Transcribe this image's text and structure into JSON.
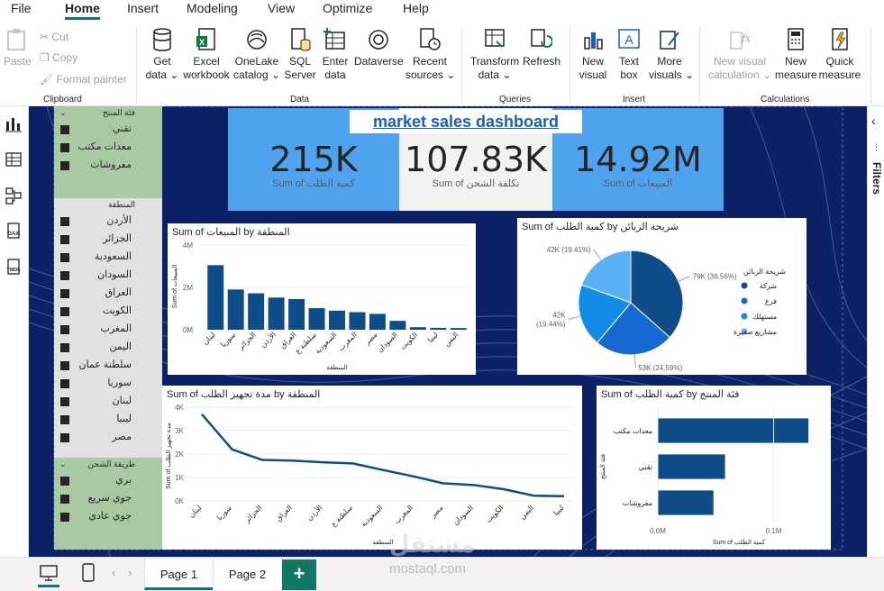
{
  "menu": {
    "items": [
      "File",
      "Home",
      "Insert",
      "Modeling",
      "View",
      "Optimize",
      "Help"
    ],
    "active": "Home"
  },
  "ribbon": {
    "clipboard": {
      "paste": "Paste",
      "cut": "Cut",
      "copy": "Copy",
      "format_painter": "Format painter",
      "group": "Clipboard"
    },
    "data": {
      "group": "Data",
      "buttons": [
        {
          "l1": "Get",
          "l2": "data ⌄"
        },
        {
          "l1": "Excel",
          "l2": "workbook"
        },
        {
          "l1": "OneLake",
          "l2": "catalog ⌄"
        },
        {
          "l1": "SQL",
          "l2": "Server"
        },
        {
          "l1": "Enter",
          "l2": "data"
        },
        {
          "l1": "Dataverse",
          "l2": ""
        },
        {
          "l1": "Recent",
          "l2": "sources ⌄"
        }
      ]
    },
    "queries": {
      "group": "Queries",
      "buttons": [
        {
          "l1": "Transform",
          "l2": "data ⌄"
        },
        {
          "l1": "Refresh",
          "l2": ""
        }
      ]
    },
    "insert": {
      "group": "Insert",
      "buttons": [
        {
          "l1": "New",
          "l2": "visual"
        },
        {
          "l1": "Text",
          "l2": "box"
        },
        {
          "l1": "More",
          "l2": "visuals ⌄"
        }
      ]
    },
    "calculations": {
      "group": "Calculations",
      "buttons": [
        {
          "l1": "New visual",
          "l2": "calculation ⌄"
        },
        {
          "l1": "New",
          "l2": "measure"
        },
        {
          "l1": "Quick",
          "l2": "measure"
        }
      ]
    }
  },
  "right_pane": {
    "label": "Filters"
  },
  "pages": {
    "tabs": [
      "Page 1",
      "Page 2"
    ],
    "active": "Page 1",
    "add": "+"
  },
  "watermark": {
    "logo": "مستقل",
    "url": "mostaql.com"
  },
  "dashboard": {
    "title": "market sales dashboard",
    "kpis": [
      {
        "value": "215K",
        "label": "Sum of كمية الطلب"
      },
      {
        "value": "107.83K",
        "label": "Sum of تكلفة الشحن"
      },
      {
        "value": "14.92M",
        "label": "Sum of المبيعات"
      }
    ],
    "slicers": {
      "category": {
        "title": "فئة المنتج",
        "items": [
          "تقني",
          "معدات مكتب",
          "مفروشات"
        ]
      },
      "region": {
        "title": "المنطقة",
        "items": [
          "الأردن",
          "الجزائر",
          "السعودية",
          "السودان",
          "العراق",
          "الكويت",
          "المغرب",
          "اليمن",
          "سلطنة عمان",
          "سوريا",
          "لبنان",
          "ليبيا",
          "مصر"
        ]
      },
      "shipping": {
        "title": "طريقة الشحن",
        "items": [
          "بري",
          "جوي سريع",
          "جوي عادي"
        ]
      }
    }
  },
  "chart_data": [
    {
      "id": "sales-by-region",
      "type": "bar",
      "title": "Sum of المبيعات by المنطقة",
      "xlabel": "المنطقة",
      "ylabel": "Sum of المبيعات",
      "categories": [
        "لبنان",
        "سوريا",
        "الجزائر",
        "الأردن",
        "العراق",
        "سلطنة ع",
        "السعودية",
        "المغرب",
        "مصر",
        "السودان",
        "الكويت",
        "ليبيا",
        "اليمن"
      ],
      "values": [
        3.05,
        1.9,
        1.72,
        1.52,
        1.45,
        1.02,
        0.9,
        0.83,
        0.75,
        0.42,
        0.12,
        0.09,
        0.08
      ],
      "ylim": [
        0,
        4
      ],
      "yticks": [
        "0M",
        "2M",
        "4M"
      ],
      "color": "#0f4c8a"
    },
    {
      "id": "quantity-by-segment",
      "type": "pie",
      "title": "Sum of كمية الطلب by شريحة الزبائن",
      "legend_title": "شريحة الزبائن",
      "legend_position": "right",
      "labels": [
        "شركة",
        "فرع",
        "مستهلك",
        "مشاريع صغيرة"
      ],
      "values": [
        79,
        53,
        42,
        42
      ],
      "data_labels": [
        "79K (36.56%)",
        "53K (24.59%)",
        "42K (19.44%)",
        "42K (19.41%)"
      ],
      "colors": [
        "#0f4c8a",
        "#1769d2",
        "#118de8",
        "#5ab0f2"
      ]
    },
    {
      "id": "prep-by-region",
      "type": "line",
      "title": "Sum of مدة تجهيز الطلب by المنطقة",
      "xlabel": "المنطقة",
      "ylabel": "Sum of مدة تجهيز الطلب",
      "categories": [
        "لبنان",
        "سوريا",
        "الجزائر",
        "العراق",
        "الأردن",
        "سلطنة ع",
        "السعودية",
        "المغرب",
        "مصر",
        "السودان",
        "الكويت",
        "اليمن",
        "ليبيا"
      ],
      "values": [
        3.7,
        2.2,
        1.75,
        1.72,
        1.65,
        1.6,
        1.32,
        1.05,
        0.75,
        0.68,
        0.5,
        0.22,
        0.2
      ],
      "ylim": [
        0,
        4
      ],
      "yticks": [
        "0K",
        "1K",
        "2K",
        "3K",
        "4K"
      ],
      "color": "#0f4c8a"
    },
    {
      "id": "quantity-by-category",
      "type": "bar",
      "orientation": "horizontal",
      "title": "Sum of كمية الطلب by فئة المنتج",
      "xlabel": "Sum of كمية الطلب",
      "ylabel": "فئة المنتج",
      "categories": [
        "معدات مكتب",
        "تقني",
        "مفروشات"
      ],
      "values": [
        0.13,
        0.058,
        0.048
      ],
      "xlim": [
        0,
        0.14
      ],
      "xticks": [
        "0.0M",
        "0.1M"
      ],
      "color": "#0f4c8a"
    }
  ]
}
